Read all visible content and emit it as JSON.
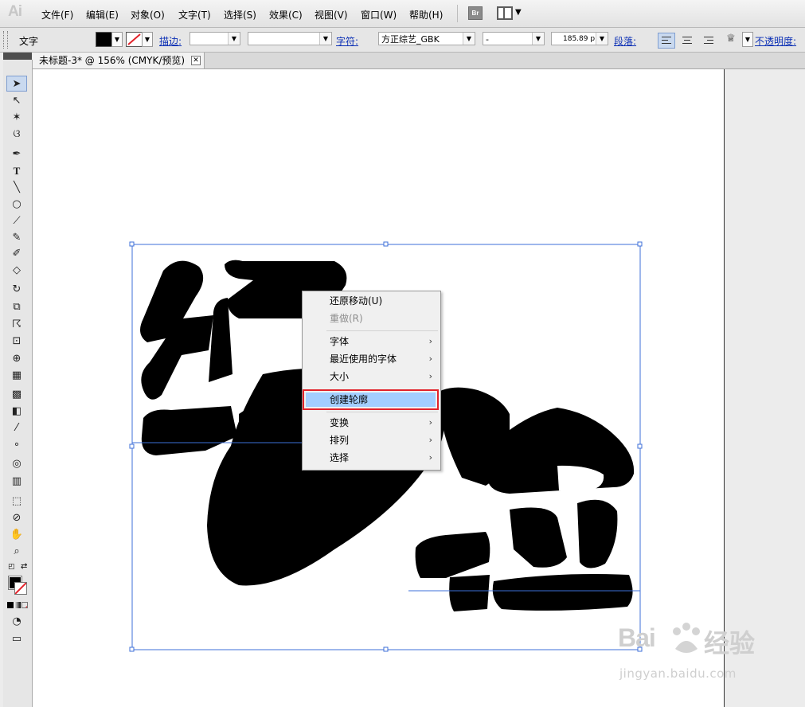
{
  "app": {
    "logo": "Ai"
  },
  "menu": {
    "items": [
      "文件(F)",
      "编辑(E)",
      "对象(O)",
      "文字(T)",
      "选择(S)",
      "效果(C)",
      "视图(V)",
      "窗口(W)",
      "帮助(H)"
    ],
    "bridge_label": "Br"
  },
  "control_bar": {
    "label": "文字",
    "stroke_label": "描边:",
    "char_label": "字符:",
    "font_value": "方正综艺_GBK",
    "style_value": "-",
    "size_value": "185.89 p",
    "para_label": "段落:",
    "opacity_label": "不透明度:"
  },
  "document": {
    "tab_title": "未标题-3* @ 156% (CMYK/预览)",
    "close_glyph": "✕"
  },
  "artwork": {
    "text": "经验"
  },
  "context_menu": {
    "items": [
      {
        "label": "还原移动(U)",
        "submenu": false,
        "disabled": false
      },
      {
        "label": "重做(R)",
        "submenu": false,
        "disabled": true
      },
      {
        "label": "字体",
        "submenu": true,
        "disabled": false
      },
      {
        "label": "最近使用的字体",
        "submenu": true,
        "disabled": false
      },
      {
        "label": "大小",
        "submenu": true,
        "disabled": false
      },
      {
        "label": "创建轮廓",
        "submenu": false,
        "disabled": false,
        "highlighted": true
      },
      {
        "label": "变换",
        "submenu": true,
        "disabled": false
      },
      {
        "label": "排列",
        "submenu": true,
        "disabled": false
      },
      {
        "label": "选择",
        "submenu": true,
        "disabled": false
      }
    ],
    "submenu_glyph": "›"
  },
  "watermark": {
    "brand_left": "Bai",
    "brand_right": "经验",
    "url": "jingyan.baidu.com"
  },
  "colors": {
    "highlight": "#a3ceff",
    "highlight_border": "#e2232b",
    "selection": "#3d6fd8",
    "link": "#0b2fb5"
  },
  "icons": [
    "selection-tool-icon",
    "direct-selection-tool-icon",
    "magic-wand-tool-icon",
    "lasso-tool-icon",
    "pen-tool-icon",
    "type-tool-icon",
    "line-tool-icon",
    "ellipse-tool-icon",
    "paintbrush-tool-icon",
    "pencil-tool-icon",
    "blob-brush-tool-icon",
    "eraser-tool-icon",
    "rotate-tool-icon",
    "scale-tool-icon",
    "warp-tool-icon",
    "free-transform-tool-icon",
    "shape-builder-tool-icon",
    "perspective-grid-tool-icon",
    "mesh-tool-icon",
    "gradient-tool-icon",
    "eyedropper-tool-icon",
    "blend-tool-icon",
    "symbol-sprayer-tool-icon",
    "column-graph-tool-icon",
    "artboard-tool-icon",
    "slice-tool-icon",
    "hand-tool-icon",
    "zoom-tool-icon"
  ]
}
